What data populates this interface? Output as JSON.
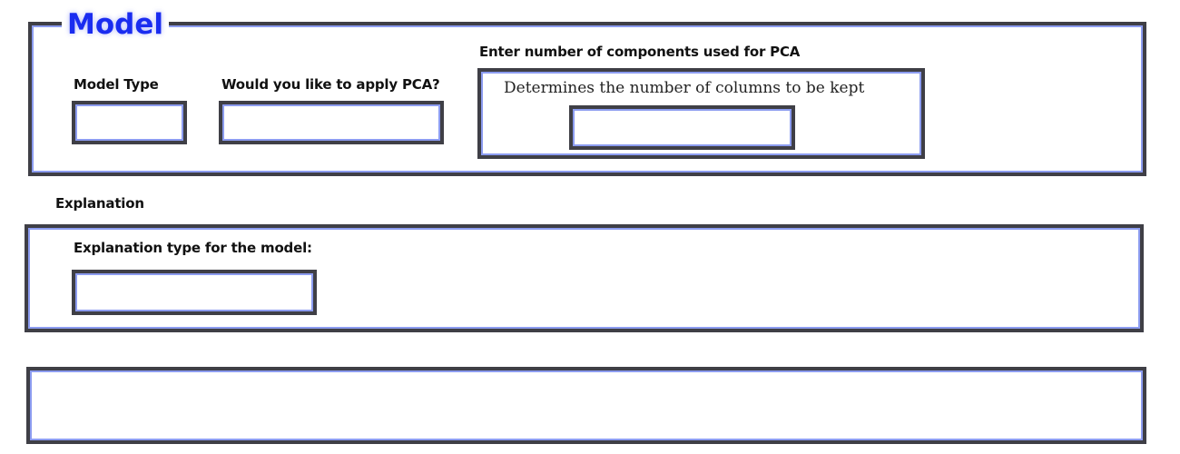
{
  "model_section": {
    "legend": "Model",
    "model_type_label": "Model Type",
    "model_type_value": "",
    "pca_question_label": "Would you like to apply PCA?",
    "pca_value": "",
    "components_label": "Enter number of components used for PCA",
    "components_hint": "Determines the number of columns to be kept",
    "components_value": ""
  },
  "explanation_section": {
    "heading": "Explanation",
    "type_label": "Explanation type for the model:",
    "type_value": ""
  },
  "output_panel": {
    "content": ""
  },
  "colors": {
    "legend": "#1a2cf0",
    "border_dark": "#3f3f46",
    "border_light": "#8c9cf0"
  }
}
